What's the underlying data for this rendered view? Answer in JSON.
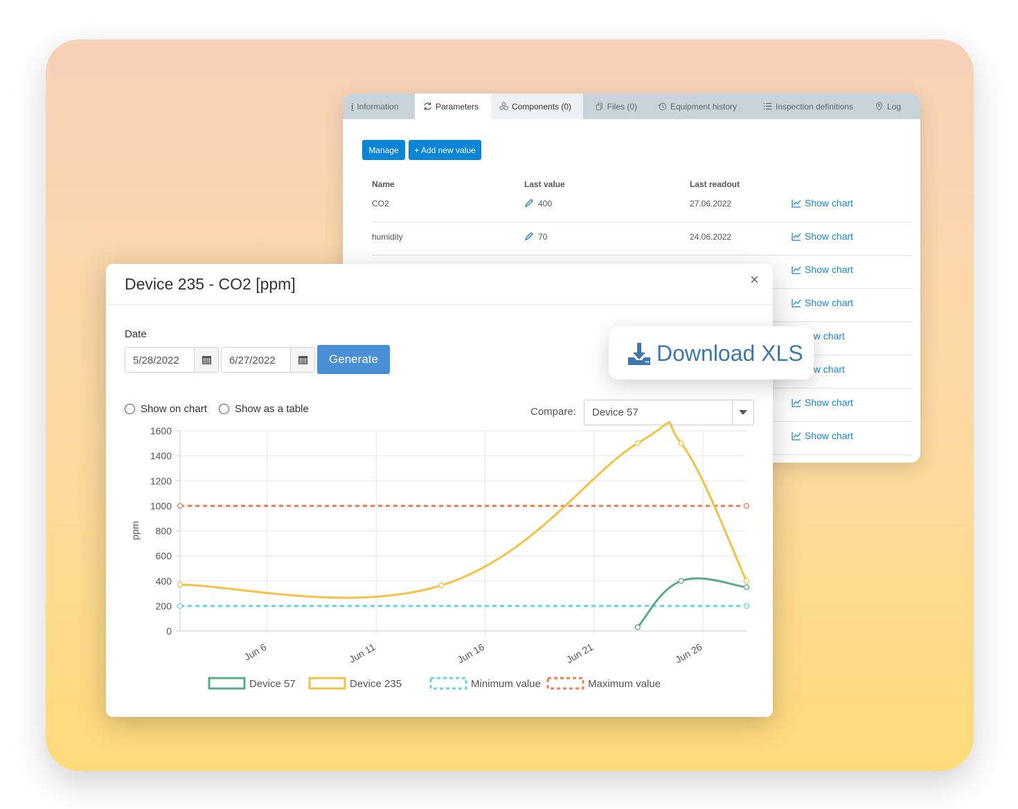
{
  "tabs": [
    {
      "label": "Information",
      "icon": "info-icon"
    },
    {
      "label": "Parameters",
      "icon": "refresh-icon"
    },
    {
      "label": "Components (0)",
      "icon": "components-icon"
    },
    {
      "label": "Files (0)",
      "icon": "files-icon"
    },
    {
      "label": "Equipment history",
      "icon": "history-icon"
    },
    {
      "label": "Inspection definitions",
      "icon": "list-icon"
    },
    {
      "label": "Log",
      "icon": "location-icon"
    }
  ],
  "toolbar": {
    "manage_label": "Manage",
    "add_label": "+ Add new value"
  },
  "table": {
    "headers": {
      "name": "Name",
      "last_value": "Last value",
      "last_readout": "Last readout"
    },
    "show_chart_label": "Show chart",
    "rows": [
      {
        "name": "CO2",
        "value": "400",
        "readout": "27.06.2022",
        "chart": "Show chart"
      },
      {
        "name": "humidity",
        "value": "70",
        "readout": "24.06.2022",
        "chart": "Show chart"
      },
      {
        "chart": "Show chart"
      },
      {
        "chart": "Show chart"
      },
      {
        "chart": "ow chart"
      },
      {
        "chart": "ow chart"
      },
      {
        "chart": "Show chart"
      },
      {
        "chart": "Show chart"
      }
    ]
  },
  "modal": {
    "title": "Device 235 - CO2 [ppm]",
    "close": "×",
    "date_label": "Date",
    "date_from": "5/28/2022",
    "date_to": "6/27/2022",
    "generate_label": "Generate",
    "radio_chart": "Show on chart",
    "radio_table": "Show as a table",
    "compare_label": "Compare:",
    "compare_value": "Device 57"
  },
  "download": {
    "label": "Download XLS"
  },
  "colors": {
    "device57": "#5aaa8a",
    "device235": "#f3c143",
    "minimum": "#63d3e0",
    "maximum": "#f07c50",
    "primary": "#0b85d8",
    "generate": "#4a8fd6"
  },
  "chart_data": {
    "type": "line",
    "ylabel": "ppm",
    "ylim": [
      0,
      1600
    ],
    "yticks": [
      0,
      200,
      400,
      600,
      800,
      1000,
      1200,
      1400,
      1600
    ],
    "x_range": [
      "2022-06-02",
      "2022-06-28"
    ],
    "xticks": [
      "Jun 6",
      "Jun 11",
      "Jun 16",
      "Jun 21",
      "Jun 26"
    ],
    "xtick_dates": [
      "2022-06-06",
      "2022-06-11",
      "2022-06-16",
      "2022-06-21",
      "2022-06-26"
    ],
    "grid": true,
    "legend": "bottom",
    "series": [
      {
        "name": "Device 57",
        "x": [
          "2022-06-23",
          "2022-06-25",
          "2022-06-28"
        ],
        "values": [
          30,
          400,
          350
        ]
      },
      {
        "name": "Device 235",
        "x": [
          "2022-06-02",
          "2022-06-14",
          "2022-06-23",
          "2022-06-25",
          "2022-06-28"
        ],
        "values": [
          370,
          365,
          1500,
          1500,
          400
        ]
      },
      {
        "name": "Minimum value",
        "x": [
          "2022-06-02",
          "2022-06-28"
        ],
        "values": [
          200,
          200
        ]
      },
      {
        "name": "Maximum value",
        "x": [
          "2022-06-02",
          "2022-06-28"
        ],
        "values": [
          1000,
          1000
        ]
      }
    ]
  }
}
